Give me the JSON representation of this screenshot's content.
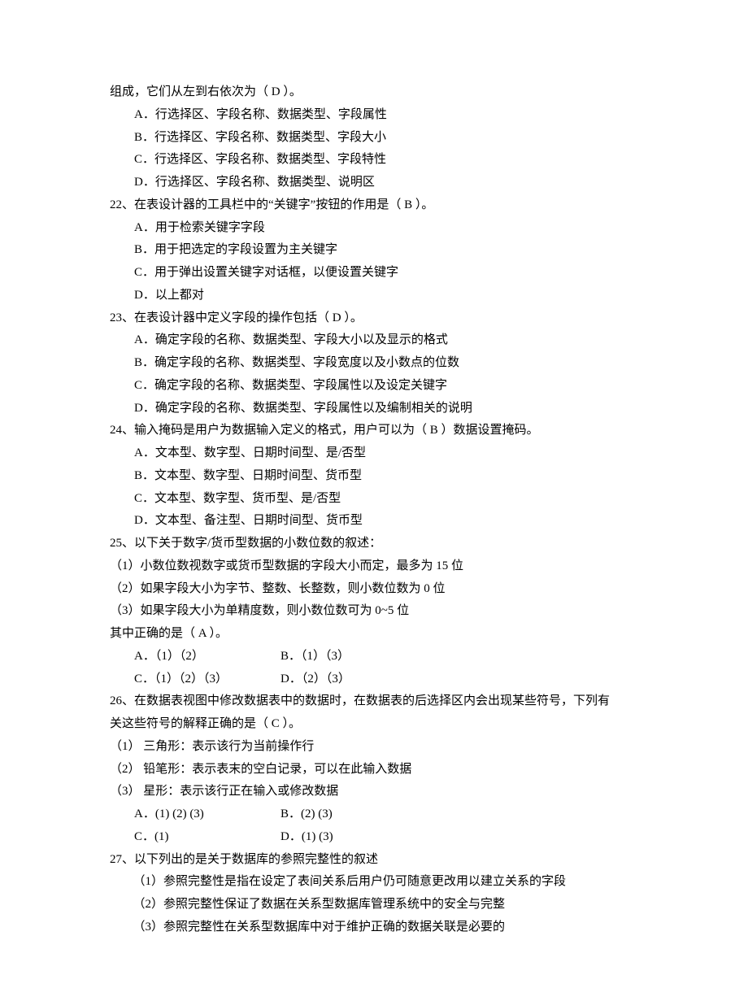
{
  "q21_cont": {
    "stem": "组成，它们从左到右依次为（ D ）。",
    "A": "A．行选择区、字段名称、数据类型、字段属性",
    "B": "B．行选择区、字段名称、数据类型、字段大小",
    "C": "C．行选择区、字段名称、数据类型、字段特性",
    "D": "D．行选择区、字段名称、数据类型、说明区"
  },
  "q22": {
    "stem": "22、在表设计器的工具栏中的“关键字”按钮的作用是（ B ）。",
    "A": "A．用于检索关键字字段",
    "B": "B．用于把选定的字段设置为主关键字",
    "C": "C．用于弹出设置关键字对话框，以便设置关键字",
    "D": "D．以上都对"
  },
  "q23": {
    "stem": "23、在表设计器中定义字段的操作包括（ D ）。",
    "A": "A．确定字段的名称、数据类型、字段大小以及显示的格式",
    "B": "B．确定字段的名称、数据类型、字段宽度以及小数点的位数",
    "C": "C．确定字段的名称、数据类型、字段属性以及设定关键字",
    "D": "D．确定字段的名称、数据类型、字段属性以及编制相关的说明"
  },
  "q24": {
    "stem": "24、输入掩码是用户为数据输入定义的格式，用户可以为（ B ）数据设置掩码。",
    "A": "A．文本型、数字型、日期时间型、是/否型",
    "B": "B．文本型、数字型、日期时间型、货币型",
    "C": "C．文本型、数字型、货币型、是/否型",
    "D": "D．文本型、备注型、日期时间型、货币型"
  },
  "q25": {
    "stem": "25、以下关于数字/货币型数据的小数位数的叙述：",
    "s1": "（1）小数位数视数字或货币型数据的字段大小而定，最多为 15 位",
    "s2": "（2）如果字段大小为字节、整数、长整数，则小数位数为 0 位",
    "s3": "（3）如果字段大小为单精度数，则小数位数可为 0~5 位",
    "tail": "其中正确的是（ A ）。",
    "A": "A．（1）（2）",
    "B": "B．（1）（3）",
    "C": "C．（1）（2）（3）",
    "D": "D．（2）（3）"
  },
  "q26": {
    "stem1": "26、在数据表视图中修改数据表中的数据时，在数据表的后选择区内会出现某些符号，下列有",
    "stem2": "关这些符号的解释正确的是（ C ）。",
    "s1": "（1） 三角形：表示该行为当前操作行",
    "s2": "（2） 铅笔形：表示表末的空白记录，可以在此输入数据",
    "s3": "（3） 星形：表示该行正在输入或修改数据",
    "A": "A．(1) (2) (3)",
    "B": "B．(2) (3)",
    "C": "C．(1)",
    "D": "D．(1) (3)"
  },
  "q27": {
    "stem": "27、以下列出的是关于数据库的参照完整性的叙述",
    "s1": "（1）参照完整性是指在设定了表间关系后用户仍可随意更改用以建立关系的字段",
    "s2": "（2）参照完整性保证了数据在关系型数据库管理系统中的安全与完整",
    "s3": "（3）参照完整性在关系型数据库中对于维护正确的数据关联是必要的"
  }
}
